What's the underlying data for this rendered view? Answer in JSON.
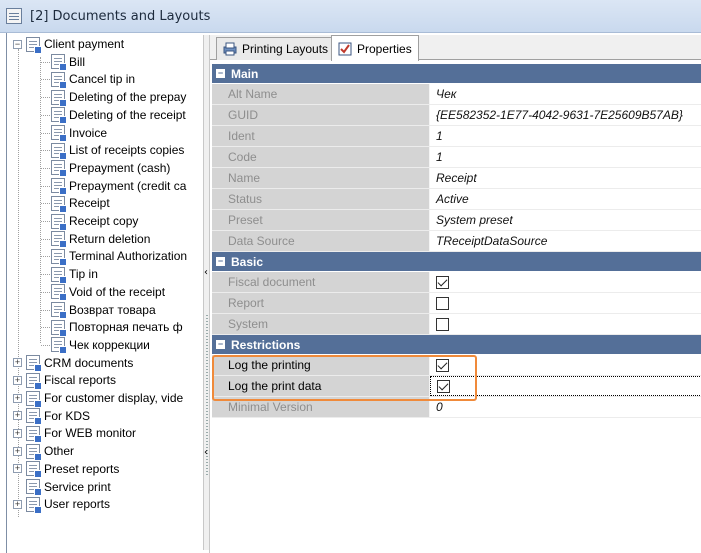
{
  "window": {
    "title": "[2] Documents and Layouts"
  },
  "tabs": [
    {
      "label": "Printing Layouts",
      "icon": "printing-layouts-icon"
    },
    {
      "label": "Properties",
      "icon": "properties-icon"
    }
  ],
  "tree": {
    "root": {
      "label": "Client payment",
      "expanded": true
    },
    "children": [
      "Bill",
      "Cancel tip in",
      "Deleting of the prepay",
      "Deleting of the receipt",
      "Invoice",
      "List of receipts copies",
      "Prepayment (cash)",
      "Prepayment (credit ca",
      "Receipt",
      "Receipt copy",
      "Return deletion",
      "Terminal Authorization",
      "Tip in",
      "Void of the receipt",
      "Возврат товара",
      "Повторная печать ф",
      "Чек коррекции"
    ],
    "groups": [
      {
        "label": "CRM documents",
        "expandable": true
      },
      {
        "label": "Fiscal reports",
        "expandable": true
      },
      {
        "label": "For customer display, vide",
        "expandable": true
      },
      {
        "label": "For KDS",
        "expandable": true
      },
      {
        "label": "For WEB monitor",
        "expandable": true
      },
      {
        "label": "Other",
        "expandable": true
      },
      {
        "label": "Preset reports",
        "expandable": true
      },
      {
        "label": "Service print",
        "expandable": false
      },
      {
        "label": "User reports",
        "expandable": true
      }
    ]
  },
  "properties": {
    "main": {
      "label": "Main",
      "rows": [
        {
          "name": "Alt Name",
          "value": "Чек"
        },
        {
          "name": "GUID",
          "value": "{EE582352-1E77-4042-9631-7E25609B57AB}"
        },
        {
          "name": "Ident",
          "value": "1"
        },
        {
          "name": "Code",
          "value": "1"
        },
        {
          "name": "Name",
          "value": "Receipt"
        },
        {
          "name": "Status",
          "value": "Active"
        },
        {
          "name": "Preset",
          "value": "System preset"
        },
        {
          "name": "Data Source",
          "value": "TReceiptDataSource"
        }
      ]
    },
    "basic": {
      "label": "Basic",
      "rows": [
        {
          "name": "Fiscal document",
          "checked": true
        },
        {
          "name": "Report",
          "checked": false
        },
        {
          "name": "System",
          "checked": false
        }
      ]
    },
    "restrictions": {
      "label": "Restrictions",
      "rows": [
        {
          "name": "Log the printing",
          "checked": true
        },
        {
          "name": "Log the print data",
          "checked": true
        },
        {
          "name": "Minimal Version",
          "value": "0"
        }
      ]
    }
  },
  "colors": {
    "category": "#546f98",
    "highlight": "#f08a3a"
  }
}
